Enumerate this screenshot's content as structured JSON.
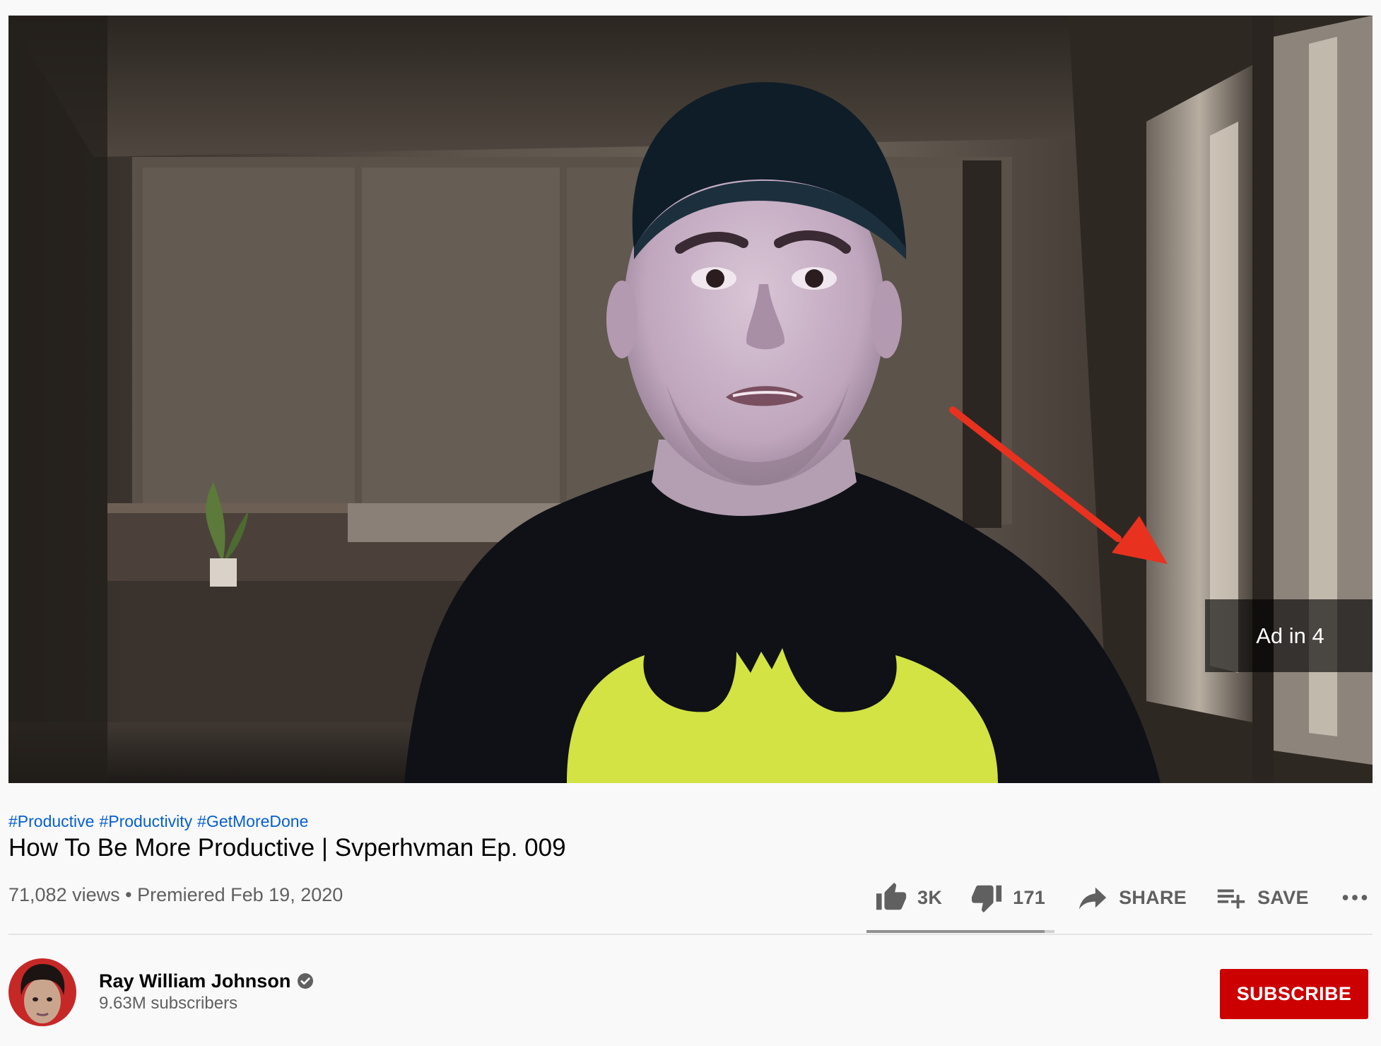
{
  "player": {
    "ad_countdown": "Ad in 4"
  },
  "video": {
    "hashtags": [
      "#Productive",
      "#Productivity",
      "#GetMoreDone"
    ],
    "title": "How To Be More Productive | Svperhvman Ep. 009",
    "views": "71,082 views",
    "separator": "•",
    "premiered": "Premiered Feb 19, 2020"
  },
  "actions": {
    "like_count": "3K",
    "dislike_count": "171",
    "share_label": "SHARE",
    "save_label": "SAVE",
    "like_ratio": 0.946
  },
  "channel": {
    "name": "Ray William Johnson",
    "subscribers": "9.63M subscribers",
    "subscribe_label": "SUBSCRIBE"
  },
  "colors": {
    "link": "#065fd4",
    "subscribe": "#cc0000",
    "annotation_arrow": "#e8321f"
  },
  "icons": {
    "like": "thumb-up-icon",
    "dislike": "thumb-down-icon",
    "share": "share-arrow-icon",
    "save": "playlist-add-icon",
    "more": "more-horizontal-icon",
    "verified": "verified-check-icon"
  }
}
